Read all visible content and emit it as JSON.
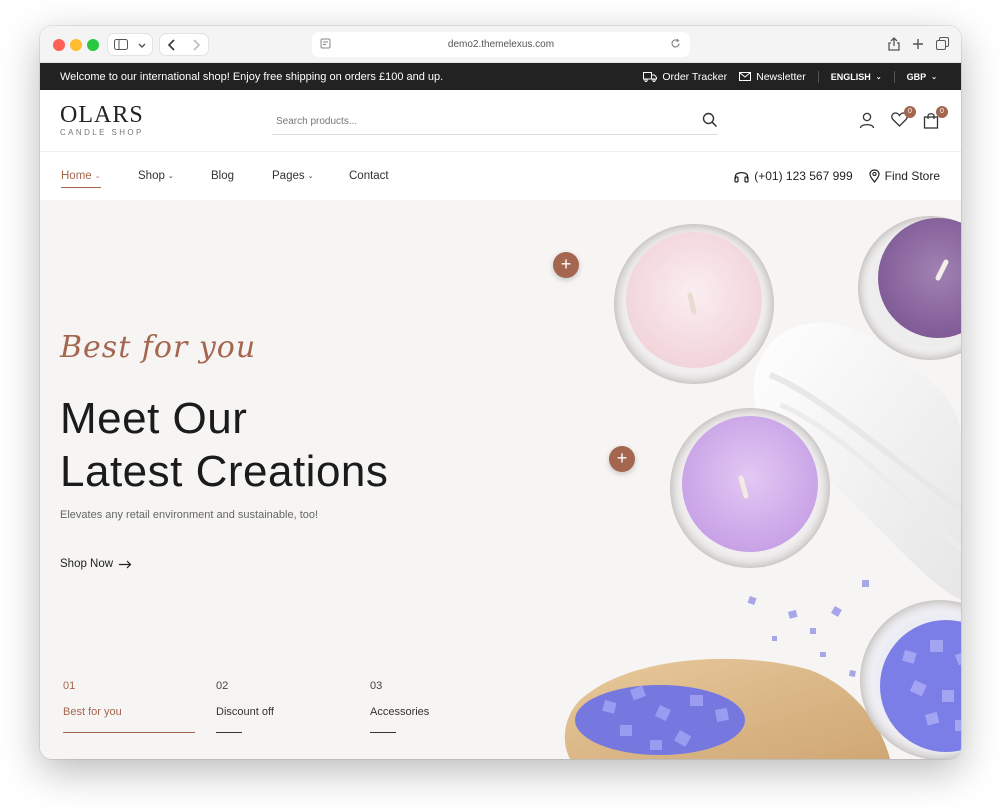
{
  "browser": {
    "url": "demo2.themelexus.com"
  },
  "topbar": {
    "message": "Welcome to our international shop! Enjoy free shipping on orders £100 and up.",
    "order_tracker": "Order Tracker",
    "newsletter": "Newsletter",
    "language": "ENGLISH",
    "currency": "GBP"
  },
  "header": {
    "logo_main": "OLARS",
    "logo_sub": "CANDLE SHOP",
    "search_placeholder": "Search products...",
    "wishlist_count": "0",
    "cart_count": "0"
  },
  "nav": {
    "items": [
      {
        "label": "Home",
        "dropdown": true,
        "active": true
      },
      {
        "label": "Shop",
        "dropdown": true
      },
      {
        "label": "Blog",
        "dropdown": false
      },
      {
        "label": "Pages",
        "dropdown": true
      },
      {
        "label": "Contact",
        "dropdown": false
      }
    ],
    "phone": "(+01) 123 567 999",
    "find_store": "Find Store"
  },
  "hero": {
    "script": "Best for you",
    "title_line1": "Meet Our",
    "title_line2": "Latest Creations",
    "subtitle": "Elevates any retail environment and sustainable, too!",
    "cta": "Shop Now",
    "tabs": [
      {
        "num": "01",
        "label": "Best for you",
        "active": true
      },
      {
        "num": "02",
        "label": "Discount off"
      },
      {
        "num": "03",
        "label": "Accessories"
      }
    ]
  },
  "colors": {
    "accent": "#a56650",
    "topbar_bg": "#222222",
    "hero_bg": "#f6f5f3"
  }
}
